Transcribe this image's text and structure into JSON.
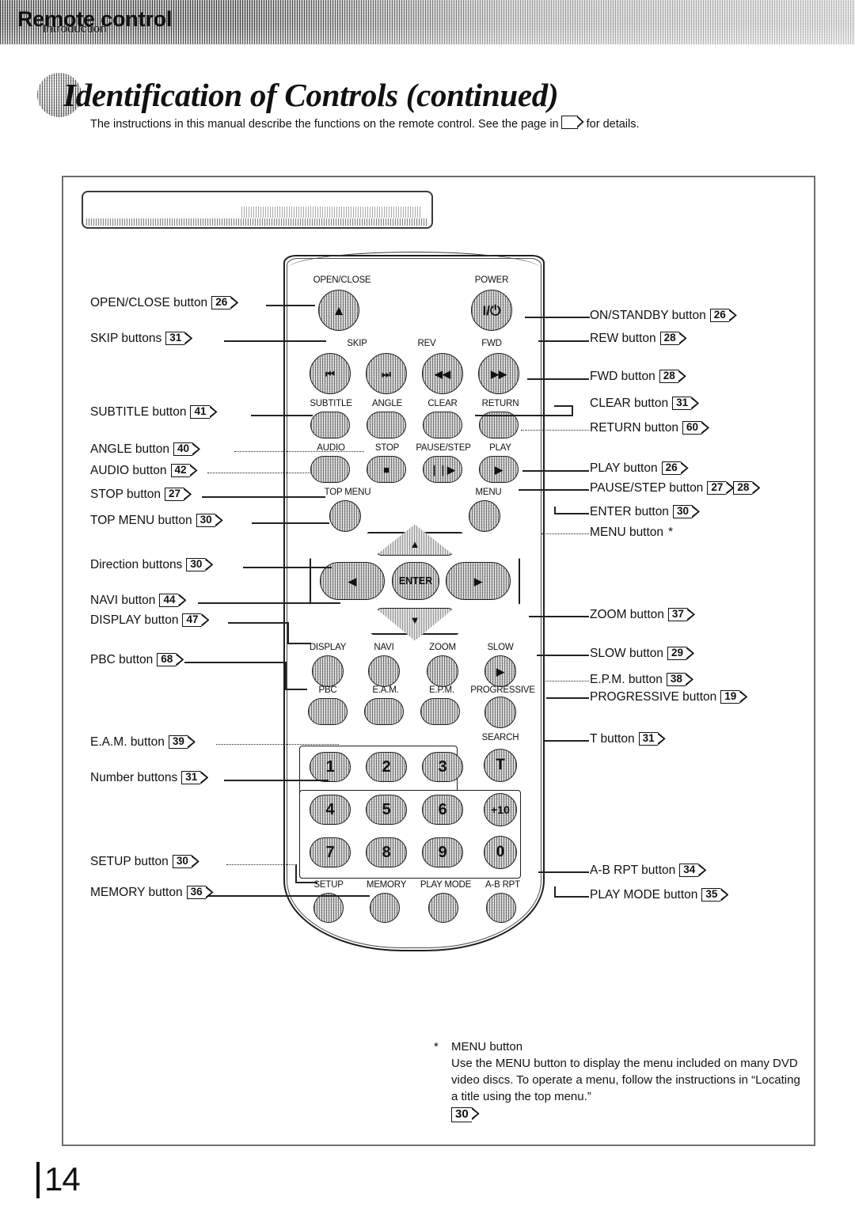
{
  "header": {
    "tab_label": "Introduction"
  },
  "title": {
    "text": "Identification of Controls (continued)",
    "intro_before": "The instructions in this manual describe the functions on the remote control. See the page in",
    "intro_after": "for details."
  },
  "section": {
    "title": "Remote control"
  },
  "labels_left": [
    {
      "name": "OPEN/CLOSE button",
      "refs": [
        "26"
      ]
    },
    {
      "name": "SKIP buttons",
      "refs": [
        "31"
      ]
    },
    {
      "name": "SUBTITLE button",
      "refs": [
        "41"
      ]
    },
    {
      "name": "ANGLE button",
      "refs": [
        "40"
      ]
    },
    {
      "name": "AUDIO button",
      "refs": [
        "42"
      ]
    },
    {
      "name": "STOP button",
      "refs": [
        "27"
      ]
    },
    {
      "name": "TOP MENU button",
      "refs": [
        "30"
      ]
    },
    {
      "name": "Direction buttons",
      "refs": [
        "30"
      ]
    },
    {
      "name": "NAVI button",
      "refs": [
        "44"
      ]
    },
    {
      "name": "DISPLAY button",
      "refs": [
        "47"
      ]
    },
    {
      "name": "PBC button",
      "refs": [
        "68"
      ]
    },
    {
      "name": "E.A.M. button",
      "refs": [
        "39"
      ]
    },
    {
      "name": "Number buttons",
      "refs": [
        "31"
      ]
    },
    {
      "name": "SETUP button",
      "refs": [
        "30"
      ]
    },
    {
      "name": "MEMORY button",
      "refs": [
        "36"
      ]
    }
  ],
  "labels_right": [
    {
      "name": "ON/STANDBY button",
      "refs": [
        "26"
      ]
    },
    {
      "name": "REW button",
      "refs": [
        "28"
      ]
    },
    {
      "name": "FWD button",
      "refs": [
        "28"
      ]
    },
    {
      "name": "CLEAR button",
      "refs": [
        "31"
      ]
    },
    {
      "name": "RETURN button",
      "refs": [
        "60"
      ]
    },
    {
      "name": "PLAY button",
      "refs": [
        "26"
      ]
    },
    {
      "name": "PAUSE/STEP button",
      "refs": [
        "27",
        "28"
      ]
    },
    {
      "name": "ENTER button",
      "refs": [
        "30"
      ]
    },
    {
      "name": "MENU button",
      "refs": [],
      "footnote_marker": "*"
    },
    {
      "name": "ZOOM button",
      "refs": [
        "37"
      ]
    },
    {
      "name": "SLOW button",
      "refs": [
        "29"
      ]
    },
    {
      "name": "E.P.M. button",
      "refs": [
        "38"
      ]
    },
    {
      "name": "PROGRESSIVE button",
      "refs": [
        "19"
      ]
    },
    {
      "name": "T button",
      "refs": [
        "31"
      ]
    },
    {
      "name": "A-B RPT button",
      "refs": [
        "34"
      ]
    },
    {
      "name": "PLAY MODE button",
      "refs": [
        "35"
      ]
    }
  ],
  "remote": {
    "key_captions": {
      "open_close": "OPEN/CLOSE",
      "power": "POWER",
      "skip": "SKIP",
      "rev": "REV",
      "fwd": "FWD",
      "subtitle": "SUBTITLE",
      "angle": "ANGLE",
      "clear": "CLEAR",
      "return": "RETURN",
      "audio": "AUDIO",
      "stop": "STOP",
      "pause_step": "PAUSE/STEP",
      "play": "PLAY",
      "top_menu": "TOP MENU",
      "menu": "MENU",
      "display": "DISPLAY",
      "navi": "NAVI",
      "zoom": "ZOOM",
      "slow": "SLOW",
      "pbc": "PBC",
      "eam": "E.A.M.",
      "epm": "E.P.M.",
      "progressive": "PROGRESSIVE",
      "search": "SEARCH",
      "setup": "SETUP",
      "memory": "MEMORY",
      "play_mode": "PLAY MODE",
      "ab_rpt": "A-B RPT"
    },
    "key_glyphs": {
      "open_close": "▲",
      "power": "I/⏻",
      "skip_prev": "⏮",
      "skip_next": "⏭",
      "rev": "◀◀",
      "fwd": "▶▶",
      "stop": "■",
      "pause_step": "❘❘▶",
      "play": "▶",
      "slow": "▶",
      "enter": "ENTER",
      "up": "▲",
      "down": "▼",
      "left": "◀",
      "right": "▶"
    },
    "numpad": [
      "1",
      "2",
      "3",
      "4",
      "5",
      "6",
      "7",
      "8",
      "9"
    ],
    "side_keys": [
      "T",
      "+10",
      "0"
    ]
  },
  "footnote": {
    "marker": "*",
    "heading": "MENU button",
    "body": "Use the MENU button to display the menu included on many DVD video discs. To operate a menu, follow the instructions in “Locating a title using the top menu.”",
    "ref": "30"
  },
  "page_number": "14"
}
